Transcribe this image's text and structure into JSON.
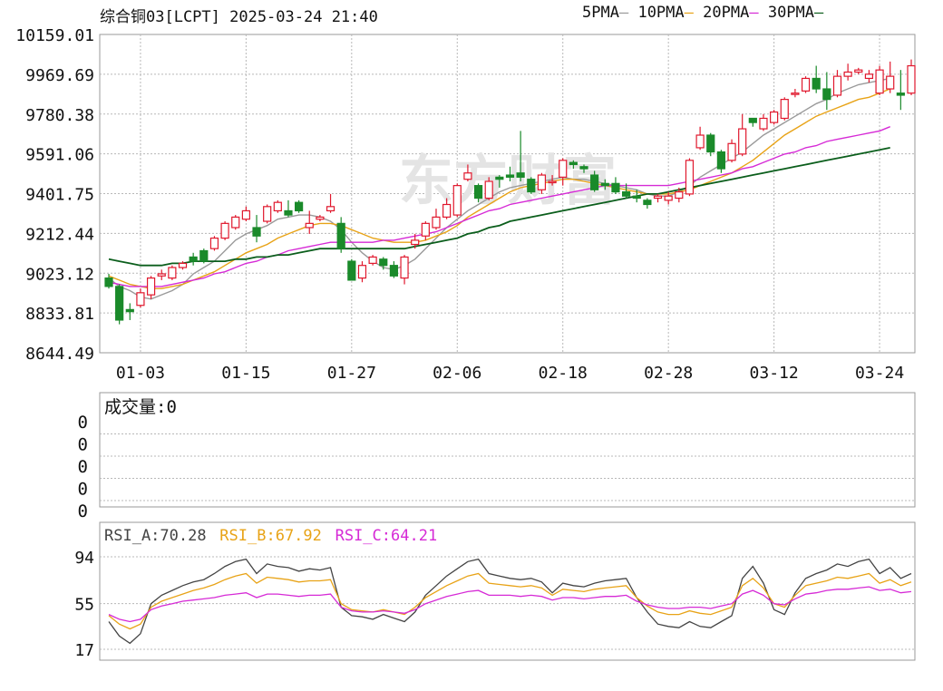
{
  "header": {
    "title": "综合铜03[LCPT] 2025-03-24 21:40",
    "legend": [
      {
        "label": "5PMA",
        "color": "#9a9a9a"
      },
      {
        "label": "10PMA",
        "color": "#e8a317"
      },
      {
        "label": "20PMA",
        "color": "#d62ad6"
      },
      {
        "label": "30PMA",
        "color": "#0b5e1c"
      }
    ]
  },
  "watermark": "东方财富",
  "colors": {
    "up": "#e0182d",
    "down": "#1a8a2a",
    "grid": "#b8b8b8",
    "frame": "#999999"
  },
  "chart_data": [
    {
      "type": "candlestick",
      "title": "综合铜03[LCPT] 2025-03-24 21:40",
      "y_ticks": [
        "10159.01",
        "9969.69",
        "9780.38",
        "9591.06",
        "9401.75",
        "9212.44",
        "9023.12",
        "8833.81",
        "8644.49"
      ],
      "ylim": [
        8644.49,
        10159.01
      ],
      "x_ticks": [
        "01-03",
        "01-15",
        "01-27",
        "02-06",
        "02-18",
        "02-28",
        "03-12",
        "03-24"
      ],
      "x_tick_index": [
        3,
        13,
        23,
        33,
        43,
        53,
        63,
        73
      ],
      "candles": [
        [
          9000,
          8960,
          9020,
          8950
        ],
        [
          8960,
          8800,
          8970,
          8780
        ],
        [
          8850,
          8840,
          8880,
          8800
        ],
        [
          8870,
          8930,
          8950,
          8860
        ],
        [
          8920,
          9000,
          9010,
          8900
        ],
        [
          9010,
          9020,
          9040,
          8990
        ],
        [
          9000,
          9050,
          9060,
          8990
        ],
        [
          9050,
          9070,
          9080,
          9040
        ],
        [
          9100,
          9080,
          9120,
          9060
        ],
        [
          9130,
          9080,
          9140,
          9070
        ],
        [
          9140,
          9190,
          9200,
          9130
        ],
        [
          9190,
          9260,
          9270,
          9180
        ],
        [
          9240,
          9290,
          9300,
          9230
        ],
        [
          9280,
          9320,
          9340,
          9270
        ],
        [
          9240,
          9200,
          9300,
          9170
        ],
        [
          9270,
          9340,
          9350,
          9260
        ],
        [
          9320,
          9360,
          9370,
          9310
        ],
        [
          9320,
          9300,
          9370,
          9290
        ],
        [
          9360,
          9320,
          9370,
          9310
        ],
        [
          9240,
          9260,
          9320,
          9210
        ],
        [
          9280,
          9290,
          9300,
          9270
        ],
        [
          9320,
          9340,
          9400,
          9310
        ],
        [
          9260,
          9140,
          9290,
          9120
        ],
        [
          9080,
          8990,
          9090,
          8990
        ],
        [
          9000,
          9060,
          9080,
          8980
        ],
        [
          9070,
          9100,
          9110,
          9060
        ],
        [
          9090,
          9060,
          9100,
          9040
        ],
        [
          9060,
          9010,
          9080,
          9000
        ],
        [
          9000,
          9100,
          9110,
          8970
        ],
        [
          9160,
          9180,
          9210,
          9140
        ],
        [
          9200,
          9260,
          9270,
          9180
        ],
        [
          9240,
          9290,
          9330,
          9230
        ],
        [
          9290,
          9350,
          9380,
          9280
        ],
        [
          9300,
          9440,
          9450,
          9290
        ],
        [
          9470,
          9500,
          9540,
          9460
        ],
        [
          9440,
          9380,
          9450,
          9360
        ],
        [
          9380,
          9460,
          9480,
          9370
        ],
        [
          9480,
          9470,
          9490,
          9430
        ],
        [
          9490,
          9480,
          9530,
          9460
        ],
        [
          9500,
          9480,
          9700,
          9460
        ],
        [
          9470,
          9410,
          9480,
          9400
        ],
        [
          9420,
          9490,
          9500,
          9400
        ],
        [
          9460,
          9460,
          9490,
          9440
        ],
        [
          9480,
          9560,
          9570,
          9440
        ],
        [
          9550,
          9540,
          9560,
          9520
        ],
        [
          9530,
          9520,
          9540,
          9500
        ],
        [
          9490,
          9420,
          9510,
          9410
        ],
        [
          9450,
          9440,
          9470,
          9420
        ],
        [
          9450,
          9410,
          9480,
          9400
        ],
        [
          9410,
          9390,
          9450,
          9380
        ],
        [
          9390,
          9380,
          9420,
          9360
        ],
        [
          9370,
          9350,
          9380,
          9330
        ],
        [
          9380,
          9390,
          9400,
          9360
        ],
        [
          9370,
          9390,
          9410,
          9350
        ],
        [
          9380,
          9410,
          9430,
          9360
        ],
        [
          9400,
          9560,
          9570,
          9390
        ],
        [
          9620,
          9680,
          9720,
          9610
        ],
        [
          9680,
          9600,
          9690,
          9580
        ],
        [
          9600,
          9520,
          9610,
          9500
        ],
        [
          9560,
          9640,
          9660,
          9550
        ],
        [
          9590,
          9710,
          9780,
          9580
        ],
        [
          9760,
          9740,
          9760,
          9720
        ],
        [
          9710,
          9760,
          9780,
          9700
        ],
        [
          9740,
          9790,
          9800,
          9730
        ],
        [
          9760,
          9850,
          9860,
          9750
        ],
        [
          9880,
          9880,
          9900,
          9860
        ],
        [
          9890,
          9950,
          9960,
          9880
        ],
        [
          9950,
          9900,
          10010,
          9880
        ],
        [
          9900,
          9850,
          9980,
          9800
        ],
        [
          9870,
          9960,
          9990,
          9860
        ],
        [
          9960,
          9980,
          10020,
          9940
        ],
        [
          9980,
          9990,
          10000,
          9970
        ],
        [
          9950,
          9970,
          9990,
          9930
        ],
        [
          9880,
          9990,
          10010,
          9870
        ],
        [
          9900,
          9960,
          10030,
          9880
        ],
        [
          9880,
          9870,
          9990,
          9800
        ],
        [
          9880,
          10010,
          10040,
          9870
        ]
      ],
      "series": [
        {
          "name": "5PMA",
          "values": [
            9000,
            8960,
            8940,
            8910,
            8900,
            8920,
            8940,
            8970,
            9020,
            9050,
            9080,
            9130,
            9180,
            9210,
            9230,
            9250,
            9280,
            9290,
            9300,
            9300,
            9290,
            9270,
            9230,
            9170,
            9120,
            9080,
            9050,
            9040,
            9060,
            9090,
            9140,
            9190,
            9240,
            9280,
            9320,
            9350,
            9380,
            9410,
            9430,
            9440,
            9450,
            9460,
            9470,
            9480,
            9470,
            9470,
            9460,
            9450,
            9440,
            9430,
            9420,
            9400,
            9390,
            9390,
            9410,
            9440,
            9480,
            9510,
            9540,
            9570,
            9600,
            9640,
            9680,
            9710,
            9740,
            9770,
            9800,
            9830,
            9850,
            9880,
            9900,
            9920,
            9930,
            9940,
            9950
          ]
        },
        {
          "name": "10PMA",
          "values": [
            9010,
            8990,
            8970,
            8960,
            8950,
            8950,
            8960,
            8970,
            8990,
            9010,
            9030,
            9060,
            9090,
            9120,
            9140,
            9160,
            9190,
            9210,
            9230,
            9250,
            9260,
            9260,
            9250,
            9230,
            9210,
            9190,
            9180,
            9170,
            9170,
            9170,
            9180,
            9200,
            9220,
            9250,
            9290,
            9320,
            9350,
            9380,
            9410,
            9430,
            9440,
            9450,
            9460,
            9470,
            9470,
            9460,
            9450,
            9440,
            9430,
            9420,
            9410,
            9400,
            9400,
            9400,
            9410,
            9420,
            9440,
            9460,
            9480,
            9500,
            9530,
            9560,
            9600,
            9640,
            9680,
            9710,
            9740,
            9770,
            9790,
            9810,
            9830,
            9850,
            9860,
            9880,
            9900
          ]
        },
        {
          "name": "20PMA",
          "values": [
            8980,
            8970,
            8960,
            8960,
            8960,
            8960,
            8970,
            8980,
            8990,
            9000,
            9020,
            9030,
            9050,
            9070,
            9080,
            9100,
            9110,
            9130,
            9140,
            9150,
            9160,
            9170,
            9170,
            9170,
            9170,
            9170,
            9180,
            9180,
            9190,
            9200,
            9210,
            9220,
            9240,
            9260,
            9280,
            9300,
            9320,
            9330,
            9350,
            9360,
            9370,
            9380,
            9390,
            9400,
            9410,
            9420,
            9430,
            9440,
            9440,
            9440,
            9440,
            9440,
            9440,
            9440,
            9450,
            9460,
            9470,
            9480,
            9490,
            9500,
            9520,
            9530,
            9550,
            9570,
            9590,
            9600,
            9620,
            9630,
            9650,
            9660,
            9670,
            9680,
            9690,
            9700,
            9720
          ]
        },
        {
          "name": "30PMA",
          "values": [
            9090,
            9080,
            9070,
            9060,
            9060,
            9060,
            9070,
            9070,
            9080,
            9080,
            9080,
            9080,
            9090,
            9090,
            9100,
            9100,
            9110,
            9110,
            9120,
            9130,
            9140,
            9140,
            9140,
            9140,
            9140,
            9140,
            9140,
            9140,
            9140,
            9150,
            9160,
            9170,
            9180,
            9190,
            9210,
            9220,
            9240,
            9250,
            9270,
            9280,
            9290,
            9300,
            9310,
            9320,
            9330,
            9340,
            9350,
            9360,
            9370,
            9380,
            9390,
            9400,
            9400,
            9410,
            9420,
            9430,
            9440,
            9450,
            9460,
            9470,
            9480,
            9490,
            9500,
            9510,
            9520,
            9530,
            9540,
            9550,
            9560,
            9570,
            9580,
            9590,
            9600,
            9610,
            9620
          ]
        }
      ]
    },
    {
      "type": "bar",
      "title": "成交量:0",
      "y_ticks": [
        "0",
        "0",
        "0",
        "0",
        "0"
      ],
      "values": []
    },
    {
      "type": "line",
      "legend": [
        {
          "label": "RSI_A:70.28",
          "color": "#444444"
        },
        {
          "label": "RSI_B:67.92",
          "color": "#e8a317"
        },
        {
          "label": "RSI_C:64.21",
          "color": "#d62ad6"
        }
      ],
      "y_ticks": [
        "94",
        "55",
        "17"
      ],
      "ylim": [
        17,
        94
      ],
      "series": [
        {
          "name": "RSI_A",
          "values": [
            40,
            28,
            22,
            30,
            55,
            62,
            66,
            70,
            73,
            75,
            80,
            86,
            90,
            92,
            80,
            88,
            86,
            85,
            82,
            84,
            83,
            85,
            52,
            45,
            44,
            42,
            46,
            43,
            40,
            48,
            62,
            70,
            78,
            84,
            90,
            92,
            80,
            78,
            76,
            75,
            76,
            73,
            64,
            72,
            70,
            69,
            72,
            74,
            75,
            76,
            60,
            48,
            38,
            36,
            35,
            40,
            36,
            35,
            40,
            45,
            76,
            86,
            72,
            50,
            46,
            64,
            76,
            80,
            83,
            88,
            86,
            90,
            92,
            80,
            85,
            76,
            80
          ]
        },
        {
          "name": "RSI_B",
          "values": [
            45,
            38,
            34,
            38,
            52,
            57,
            60,
            63,
            66,
            68,
            71,
            75,
            78,
            80,
            72,
            77,
            76,
            75,
            73,
            74,
            74,
            75,
            55,
            50,
            49,
            48,
            50,
            48,
            46,
            52,
            60,
            65,
            70,
            74,
            78,
            80,
            72,
            71,
            70,
            69,
            70,
            68,
            62,
            67,
            66,
            65,
            67,
            68,
            69,
            70,
            60,
            53,
            48,
            46,
            46,
            49,
            47,
            46,
            49,
            52,
            70,
            76,
            68,
            55,
            52,
            62,
            70,
            72,
            74,
            77,
            76,
            78,
            80,
            72,
            75,
            70,
            73
          ]
        },
        {
          "name": "RSI_C",
          "values": [
            46,
            42,
            40,
            42,
            50,
            53,
            55,
            57,
            58,
            59,
            60,
            62,
            63,
            64,
            60,
            63,
            63,
            62,
            61,
            62,
            62,
            63,
            52,
            49,
            48,
            48,
            49,
            48,
            47,
            50,
            55,
            58,
            61,
            63,
            65,
            66,
            62,
            62,
            62,
            61,
            62,
            61,
            58,
            60,
            60,
            59,
            60,
            61,
            61,
            62,
            57,
            54,
            52,
            51,
            51,
            52,
            52,
            51,
            53,
            55,
            63,
            66,
            62,
            55,
            54,
            59,
            63,
            64,
            66,
            67,
            67,
            68,
            69,
            66,
            67,
            64,
            65
          ]
        }
      ]
    }
  ]
}
